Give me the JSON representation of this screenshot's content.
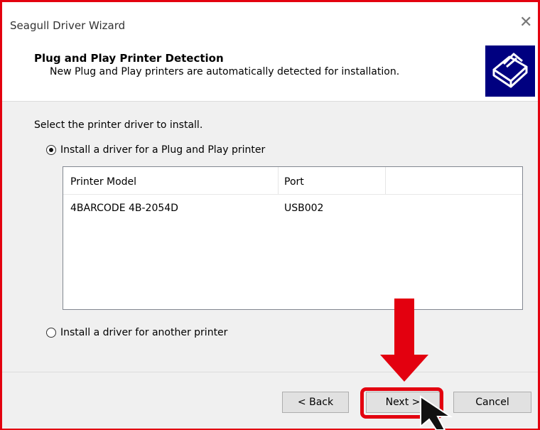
{
  "window": {
    "title": "Seagull Driver Wizard",
    "close_glyph": "✕"
  },
  "header": {
    "title": "Plug and Play Printer Detection",
    "subtitle": "New Plug and Play printers are automatically detected for installation.",
    "logo_icon": "printer-icon"
  },
  "content": {
    "prompt": "Select the printer driver to install.",
    "option_pnp": {
      "label": "Install a driver for a Plug and Play printer",
      "selected": true
    },
    "option_other": {
      "label": "Install a driver for another printer",
      "selected": false
    },
    "table": {
      "columns": [
        "Printer Model",
        "Port"
      ],
      "rows": [
        {
          "model": "4BARCODE 4B-2054D",
          "port": "USB002"
        }
      ]
    }
  },
  "buttons": {
    "back": "< Back",
    "next": "Next >",
    "cancel": "Cancel"
  },
  "colors": {
    "annotation_red": "#e3000f",
    "logo_bg": "#000080"
  }
}
